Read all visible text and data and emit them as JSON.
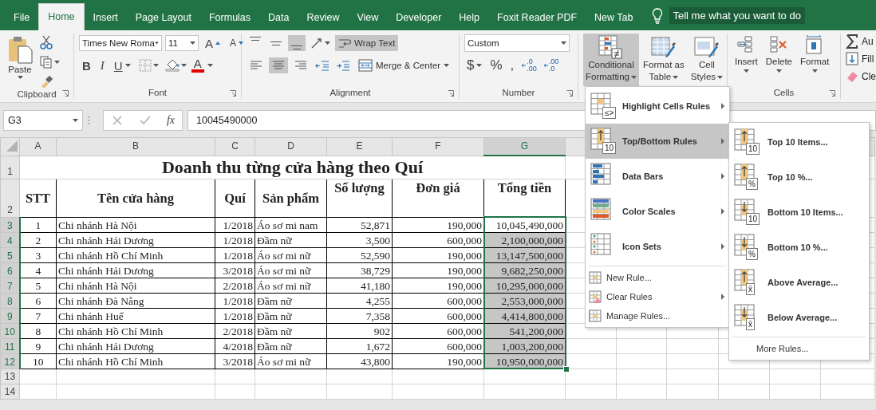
{
  "menu_tabs": [
    {
      "label": "File",
      "selected": false
    },
    {
      "label": "Home",
      "selected": true
    },
    {
      "label": "Insert",
      "selected": false
    },
    {
      "label": "Page Layout",
      "selected": false
    },
    {
      "label": "Formulas",
      "selected": false
    },
    {
      "label": "Data",
      "selected": false
    },
    {
      "label": "Review",
      "selected": false
    },
    {
      "label": "View",
      "selected": false
    },
    {
      "label": "Developer",
      "selected": false
    },
    {
      "label": "Help",
      "selected": false
    },
    {
      "label": "Foxit Reader PDF",
      "selected": false
    },
    {
      "label": "New Tab",
      "selected": false
    }
  ],
  "tell_me": "Tell me what you want to do",
  "clipboard": {
    "label": "Clipboard",
    "paste": "Paste"
  },
  "font": {
    "label": "Font",
    "name": "Times New Roma",
    "size": "11",
    "grow": "A",
    "shrink": "A",
    "styles": [
      {
        "text": "B",
        "kind": "bold"
      },
      {
        "text": "I",
        "kind": "italic"
      },
      {
        "text": "U",
        "kind": "underline"
      }
    ],
    "color_letter": "A"
  },
  "alignment": {
    "label": "Alignment",
    "vertical": [
      {
        "selected": false
      },
      {
        "selected": false
      },
      {
        "selected": true
      }
    ],
    "horizontal": [
      {
        "selected": false
      },
      {
        "selected": true
      },
      {
        "selected": false
      }
    ],
    "wrap": {
      "label": "Wrap Text",
      "selected": true
    },
    "merge": "Merge & Center"
  },
  "number": {
    "label": "Number",
    "format": "Custom",
    "symbols": [
      "$",
      "%",
      ","
    ],
    "decimals": [
      [
        ".0",
        ".00"
      ],
      [
        ".00",
        ".0"
      ]
    ]
  },
  "styles": {
    "buttons": [
      {
        "lines": [
          "Conditional",
          "Formatting"
        ],
        "selected": true
      },
      {
        "lines": [
          "Format as",
          "Table"
        ],
        "selected": false
      },
      {
        "lines": [
          "Cell",
          "Styles"
        ],
        "selected": false
      }
    ]
  },
  "cells": {
    "label": "Cells",
    "buttons": [
      "Insert",
      "Delete",
      "Format"
    ]
  },
  "editing": {
    "items": [
      "Au",
      "Fill",
      "Cle"
    ]
  },
  "formula_bar": {
    "name_box": "G3",
    "fx": "fx",
    "formula": "10045490000"
  },
  "sheet": {
    "columns": [
      {
        "letter": "A",
        "selected": false
      },
      {
        "letter": "B",
        "selected": false
      },
      {
        "letter": "C",
        "selected": false
      },
      {
        "letter": "D",
        "selected": false
      },
      {
        "letter": "E",
        "selected": false
      },
      {
        "letter": "F",
        "selected": false
      },
      {
        "letter": "G",
        "selected": true
      }
    ],
    "rows": [
      {
        "number": "1",
        "kind": "title",
        "selected": false,
        "text": "Doanh thu từng cửa hàng theo Quí"
      },
      {
        "number": "2",
        "kind": "header",
        "selected": false,
        "cells": [
          "STT",
          "Tên cửa hàng",
          "Quí",
          "Sản phẩm",
          "Số lượng",
          "Đơn giá",
          "Tổng tiền"
        ]
      },
      {
        "number": "3",
        "kind": "data",
        "selected": true,
        "active": true,
        "cells": [
          "1",
          "Chi nhánh Hà Nội",
          "1/2018",
          "Áo sơ mi nam",
          "52,871",
          "190,000",
          "10,045,490,000"
        ]
      },
      {
        "number": "4",
        "kind": "data",
        "selected": true,
        "active": false,
        "cells": [
          "2",
          "Chi nhánh Hải Dương",
          "1/2018",
          "Đầm nữ",
          "3,500",
          "600,000",
          "2,100,000,000"
        ]
      },
      {
        "number": "5",
        "kind": "data",
        "selected": true,
        "active": false,
        "cells": [
          "3",
          "Chi nhánh Hồ Chí Minh",
          "1/2018",
          "Áo sơ mi nữ",
          "52,590",
          "190,000",
          "13,147,500,000"
        ]
      },
      {
        "number": "6",
        "kind": "data",
        "selected": true,
        "active": false,
        "cells": [
          "4",
          "Chi nhánh Hải Dương",
          "3/2018",
          "Áo sơ mi nữ",
          "38,729",
          "190,000",
          "9,682,250,000"
        ]
      },
      {
        "number": "7",
        "kind": "data",
        "selected": true,
        "active": false,
        "cells": [
          "5",
          "Chi nhánh Hà Nội",
          "2/2018",
          "Áo sơ mi nữ",
          "41,180",
          "190,000",
          "10,295,000,000"
        ]
      },
      {
        "number": "8",
        "kind": "data",
        "selected": true,
        "active": false,
        "cells": [
          "6",
          "Chi nhánh Đà Nẵng",
          "1/2018",
          "Đầm nữ",
          "4,255",
          "600,000",
          "2,553,000,000"
        ]
      },
      {
        "number": "9",
        "kind": "data",
        "selected": true,
        "active": false,
        "cells": [
          "7",
          "Chi nhánh Huế",
          "1/2018",
          "Đầm nữ",
          "7,358",
          "600,000",
          "4,414,800,000"
        ]
      },
      {
        "number": "10",
        "kind": "data",
        "selected": true,
        "active": false,
        "cells": [
          "8",
          "Chi nhánh Hồ Chí Minh",
          "2/2018",
          "Đầm nữ",
          "902",
          "600,000",
          "541,200,000"
        ]
      },
      {
        "number": "11",
        "kind": "data",
        "selected": true,
        "active": false,
        "cells": [
          "9",
          "Chi nhánh Hải Dương",
          "4/2018",
          "Đầm nữ",
          "1,672",
          "600,000",
          "1,003,200,000"
        ]
      },
      {
        "number": "12",
        "kind": "data",
        "selected": true,
        "active": false,
        "cells": [
          "10",
          "Chi nhánh Hồ Chí Minh",
          "3/2018",
          "Áo sơ mi nữ",
          "43,800",
          "190,000",
          "10,950,000,000"
        ]
      },
      {
        "number": "13",
        "kind": "empty",
        "selected": false
      },
      {
        "number": "14",
        "kind": "empty",
        "selected": false
      }
    ]
  },
  "conditional_menu": {
    "items": [
      {
        "label": "Highlight Cells Rules",
        "kind": "large",
        "badge": "≤>",
        "selected": false,
        "submenu": true
      },
      {
        "label": "Top/Bottom Rules",
        "kind": "large",
        "badge": "10",
        "selected": true,
        "submenu": true
      },
      {
        "label": "Data Bars",
        "kind": "large",
        "selected": false,
        "submenu": true
      },
      {
        "label": "Color Scales",
        "kind": "large",
        "selected": false,
        "submenu": true
      },
      {
        "label": "Icon Sets",
        "kind": "large",
        "selected": false,
        "submenu": true
      },
      {
        "label": "New Rule...",
        "kind": "small",
        "selected": false,
        "submenu": false
      },
      {
        "label": "Clear Rules",
        "kind": "small",
        "selected": false,
        "submenu": true
      },
      {
        "label": "Manage Rules...",
        "kind": "small",
        "selected": false,
        "submenu": false
      }
    ]
  },
  "top_bottom_menu": {
    "items": [
      {
        "label": "Top 10 Items...",
        "kind": "large",
        "badge": "10"
      },
      {
        "label": "Top 10 %...",
        "kind": "large",
        "badge": "%"
      },
      {
        "label": "Bottom 10 Items...",
        "kind": "large",
        "badge": "10"
      },
      {
        "label": "Bottom 10 %...",
        "kind": "large",
        "badge": "%"
      },
      {
        "label": "Above Average...",
        "kind": "large",
        "badge": "x̄"
      },
      {
        "label": "Below Average...",
        "kind": "large",
        "badge": "x̄"
      },
      {
        "label": "More Rules...",
        "kind": "link"
      }
    ]
  }
}
